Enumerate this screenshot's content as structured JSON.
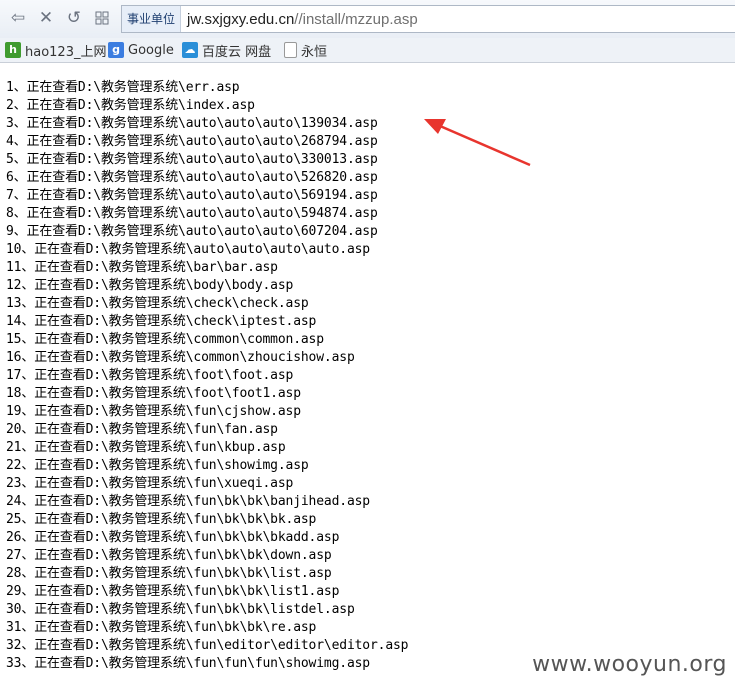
{
  "address_bar": {
    "badge": "事业单位",
    "url_host": "jw.sxjgxy.edu.cn",
    "url_path": "//install/mzzup.asp"
  },
  "bookmarks": [
    {
      "label": "hao123_上网",
      "icon": "hao123-icon"
    },
    {
      "label": "Google",
      "icon": "google-icon"
    },
    {
      "label": "百度云 网盘",
      "icon": "baidu-cloud-icon"
    },
    {
      "label": "永恒",
      "icon": "page-icon"
    }
  ],
  "lines": [
    "1、正在查看D:\\教务管理系统\\err.asp",
    "2、正在查看D:\\教务管理系统\\index.asp",
    "3、正在查看D:\\教务管理系统\\auto\\auto\\auto\\139034.asp",
    "4、正在查看D:\\教务管理系统\\auto\\auto\\auto\\268794.asp",
    "5、正在查看D:\\教务管理系统\\auto\\auto\\auto\\330013.asp",
    "6、正在查看D:\\教务管理系统\\auto\\auto\\auto\\526820.asp",
    "7、正在查看D:\\教务管理系统\\auto\\auto\\auto\\569194.asp",
    "8、正在查看D:\\教务管理系统\\auto\\auto\\auto\\594874.asp",
    "9、正在查看D:\\教务管理系统\\auto\\auto\\auto\\607204.asp",
    "10、正在查看D:\\教务管理系统\\auto\\auto\\auto\\auto.asp",
    "11、正在查看D:\\教务管理系统\\bar\\bar.asp",
    "12、正在查看D:\\教务管理系统\\body\\body.asp",
    "13、正在查看D:\\教务管理系统\\check\\check.asp",
    "14、正在查看D:\\教务管理系统\\check\\iptest.asp",
    "15、正在查看D:\\教务管理系统\\common\\common.asp",
    "16、正在查看D:\\教务管理系统\\common\\zhoucishow.asp",
    "17、正在查看D:\\教务管理系统\\foot\\foot.asp",
    "18、正在查看D:\\教务管理系统\\foot\\foot1.asp",
    "19、正在查看D:\\教务管理系统\\fun\\cjshow.asp",
    "20、正在查看D:\\教务管理系统\\fun\\fan.asp",
    "21、正在查看D:\\教务管理系统\\fun\\kbup.asp",
    "22、正在查看D:\\教务管理系统\\fun\\showimg.asp",
    "23、正在查看D:\\教务管理系统\\fun\\xueqi.asp",
    "24、正在查看D:\\教务管理系统\\fun\\bk\\bk\\banjihead.asp",
    "25、正在查看D:\\教务管理系统\\fun\\bk\\bk\\bk.asp",
    "26、正在查看D:\\教务管理系统\\fun\\bk\\bk\\bkadd.asp",
    "27、正在查看D:\\教务管理系统\\fun\\bk\\bk\\down.asp",
    "28、正在查看D:\\教务管理系统\\fun\\bk\\bk\\list.asp",
    "29、正在查看D:\\教务管理系统\\fun\\bk\\bk\\list1.asp",
    "30、正在查看D:\\教务管理系统\\fun\\bk\\bk\\listdel.asp",
    "31、正在查看D:\\教务管理系统\\fun\\bk\\bk\\re.asp",
    "32、正在查看D:\\教务管理系统\\fun\\editor\\editor\\editor.asp",
    "33、正在查看D:\\教务管理系统\\fun\\fun\\fun\\showimg.asp"
  ],
  "watermark": "www.wooyun.org",
  "colors": {
    "arrow": "#e8352e",
    "badge_text": "#1f3f70"
  }
}
